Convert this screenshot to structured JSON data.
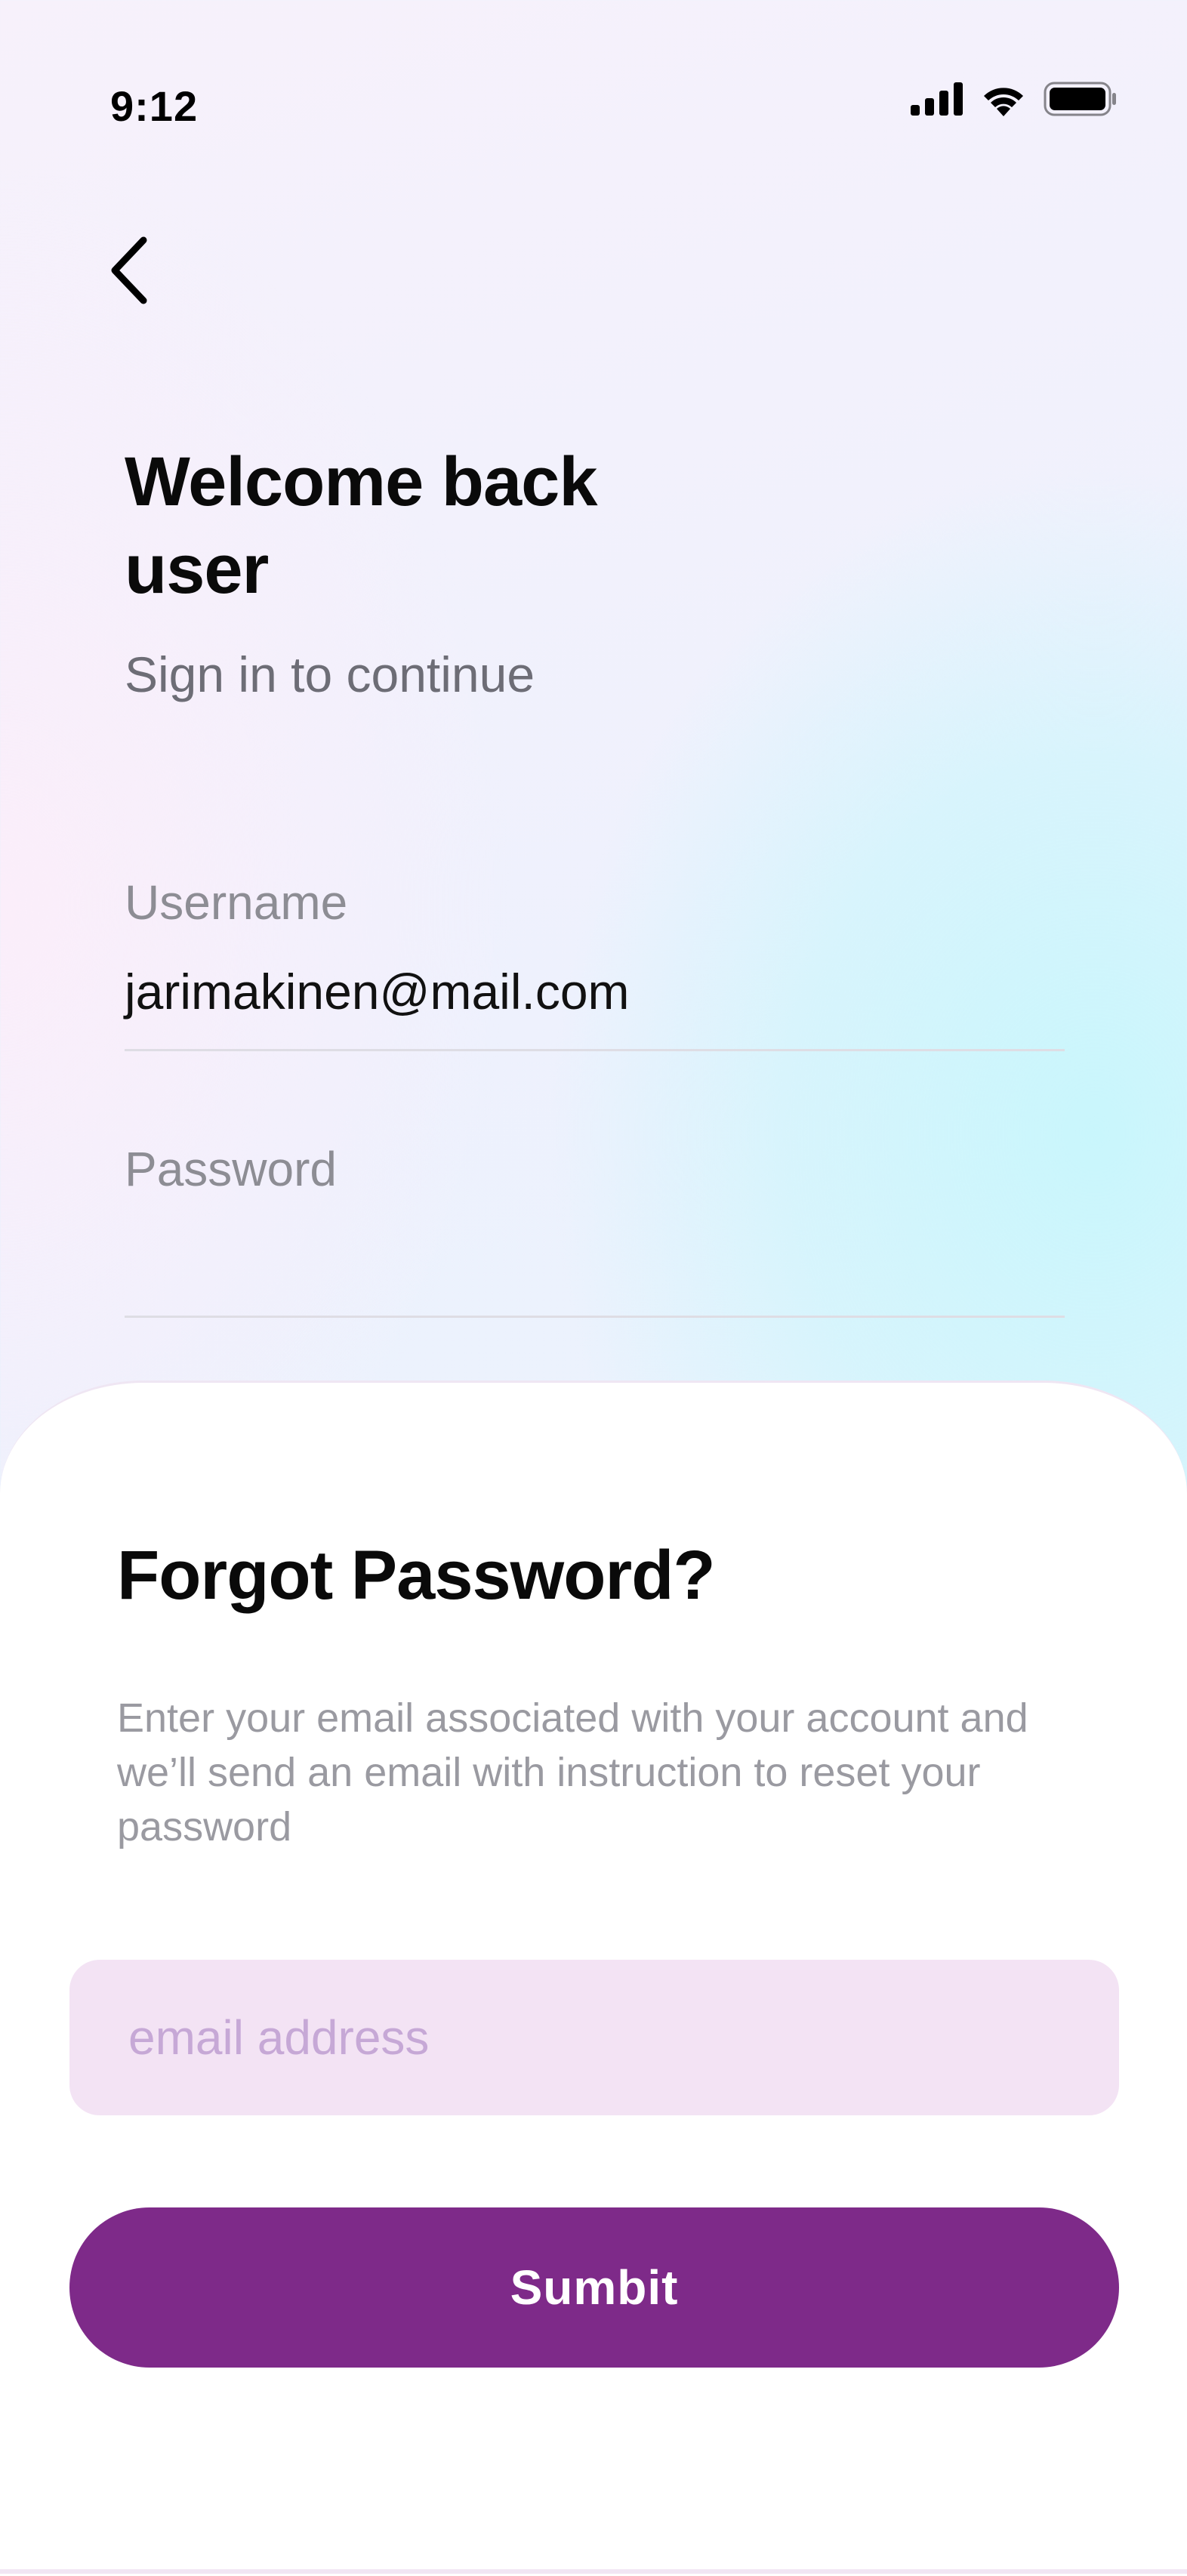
{
  "status_bar": {
    "time": "9:12",
    "icons": [
      "cellular-signal-icon",
      "wifi-icon",
      "battery-icon"
    ]
  },
  "navigation": {
    "back_icon": "chevron-left-icon"
  },
  "login": {
    "title": "Welcome back user",
    "subtitle": "Sign in to continue",
    "username": {
      "label": "Username",
      "value": "jarimakinen@mail.com"
    },
    "password": {
      "label": "Password",
      "value": ""
    }
  },
  "forgot_sheet": {
    "title": "Forgot Password?",
    "description": "Enter your email associated with your account and we’ll send an email with instruction to reset your password",
    "email_placeholder": "email address",
    "submit_label": "Sumbit"
  },
  "colors": {
    "primary": "#7e2a89",
    "input_background": "#f3e3f4",
    "placeholder": "#c6a8d6"
  }
}
